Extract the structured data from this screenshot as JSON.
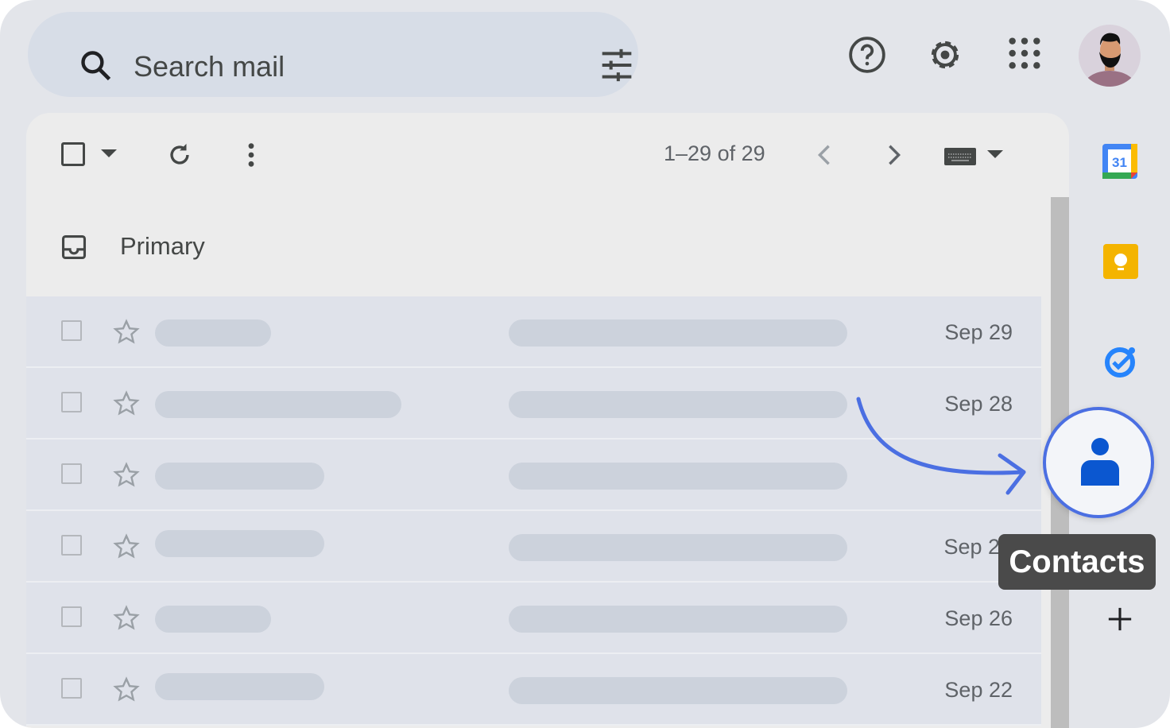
{
  "search": {
    "placeholder": "Search mail",
    "icon": "search-icon",
    "options_icon": "tune-icon"
  },
  "header": {
    "icons": [
      "help-icon",
      "settings-icon",
      "apps-grid-icon"
    ],
    "avatar": "avatar"
  },
  "toolbar": {
    "pagination": "1–29 of 29",
    "icons": [
      "checkbox-icon",
      "dropdown-icon",
      "refresh-icon",
      "more-vert-icon",
      "chevron-left-icon",
      "chevron-right-icon",
      "keyboard-icon",
      "dropdown-icon"
    ]
  },
  "tabs": {
    "primary": "Primary"
  },
  "rows": [
    {
      "date": "Sep 29"
    },
    {
      "date": "Sep 28"
    },
    {
      "date": ""
    },
    {
      "date": "Sep 2"
    },
    {
      "date": "Sep 26"
    },
    {
      "date": "Sep 22"
    }
  ],
  "side_panel": {
    "apps": [
      "calendar-icon",
      "keep-icon",
      "tasks-icon",
      "contacts-icon",
      "add-icon"
    ],
    "calendar_day": "31"
  },
  "tooltip": {
    "label": "Contacts"
  },
  "colors": {
    "annotation": "#4b6fe2",
    "contacts": "#0b57d0",
    "keep": "#f4b400",
    "tooltip_bg": "#4a4a4a"
  }
}
